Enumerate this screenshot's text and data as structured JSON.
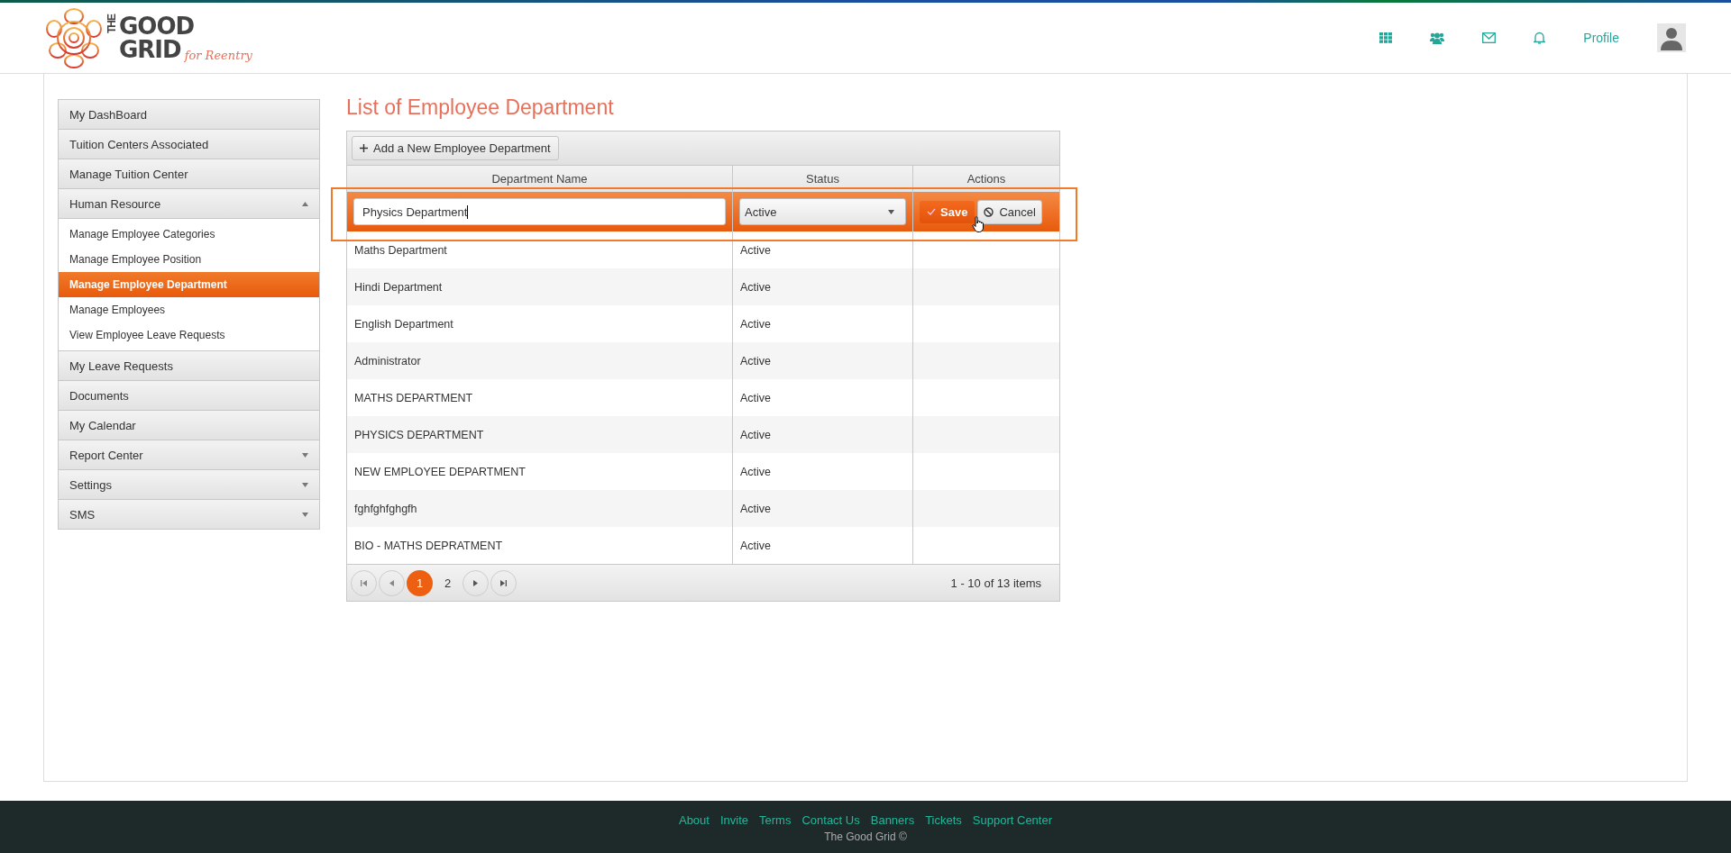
{
  "logo": {
    "the": "THE",
    "good": "GOOD",
    "grid": "GRID",
    "tagline": "for Reentry"
  },
  "header": {
    "profile_link": "Profile"
  },
  "sidebar": {
    "items": [
      {
        "label": "My DashBoard",
        "kind": "link"
      },
      {
        "label": "Tuition Centers Associated",
        "kind": "link"
      },
      {
        "label": "Manage Tuition Center",
        "kind": "link"
      },
      {
        "label": "Human Resource",
        "kind": "group",
        "expanded": true,
        "children": [
          {
            "label": "Manage Employee Categories",
            "selected": false
          },
          {
            "label": "Manage Employee Position",
            "selected": false
          },
          {
            "label": "Manage Employee Department",
            "selected": true
          },
          {
            "label": "Manage Employees",
            "selected": false
          },
          {
            "label": "View Employee Leave Requests",
            "selected": false
          }
        ]
      },
      {
        "label": "My Leave Requests",
        "kind": "link"
      },
      {
        "label": "Documents",
        "kind": "link"
      },
      {
        "label": "My Calendar",
        "kind": "link"
      },
      {
        "label": "Report Center",
        "kind": "group",
        "expanded": false
      },
      {
        "label": "Settings",
        "kind": "group",
        "expanded": false
      },
      {
        "label": "SMS",
        "kind": "group",
        "expanded": false
      }
    ]
  },
  "page_title": "List of Employee Department",
  "toolbar": {
    "add_button": "Add a New Employee Department"
  },
  "table": {
    "columns": [
      "Department Name",
      "Status",
      "Actions"
    ],
    "edit_row": {
      "name_value": "Physics Department",
      "status_value": "Active",
      "save_button": "Save",
      "cancel_button": "Cancel"
    },
    "rows": [
      {
        "name": "Maths Department",
        "status": "Active"
      },
      {
        "name": "Hindi Department",
        "status": "Active"
      },
      {
        "name": "English Department",
        "status": "Active"
      },
      {
        "name": "Administrator",
        "status": "Active"
      },
      {
        "name": "MATHS DEPARTMENT",
        "status": "Active"
      },
      {
        "name": "PHYSICS DEPARTMENT",
        "status": "Active"
      },
      {
        "name": "NEW EMPLOYEE DEPARTMENT",
        "status": "Active"
      },
      {
        "name": "fghfghfghgfh",
        "status": "Active"
      },
      {
        "name": "BIO - MATHS DEPRATMENT",
        "status": "Active"
      }
    ]
  },
  "pager": {
    "pages": [
      {
        "label": "1",
        "selected": true
      },
      {
        "label": "2",
        "selected": false
      }
    ],
    "summary": "1 - 10 of 13 items"
  },
  "footer": {
    "links": [
      "About",
      "Invite",
      "Terms",
      "Contact Us",
      "Banners",
      "Tickets",
      "Support Center"
    ],
    "copyright": "The Good Grid ©"
  }
}
